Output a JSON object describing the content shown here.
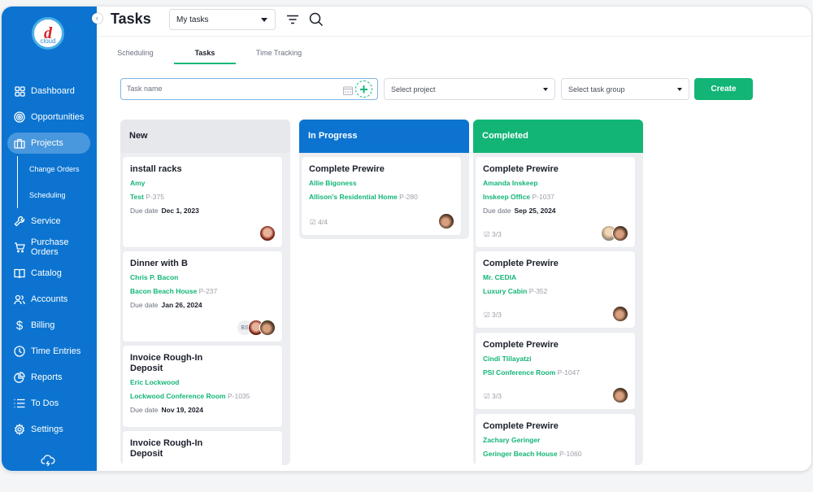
{
  "sidebar": {
    "logo_letter": "d",
    "logo_text": "cloud",
    "items": [
      {
        "label": "Dashboard",
        "icon": "dashboard-icon"
      },
      {
        "label": "Opportunities",
        "icon": "target-icon"
      },
      {
        "label": "Projects",
        "icon": "briefcase-icon",
        "active": true
      },
      {
        "label": "Change Orders",
        "sub": true
      },
      {
        "label": "Scheduling",
        "sub": true
      },
      {
        "label": "Service",
        "icon": "wrench-icon"
      },
      {
        "label": "Purchase Orders",
        "icon": "cart-icon"
      },
      {
        "label": "Catalog",
        "icon": "book-icon"
      },
      {
        "label": "Accounts",
        "icon": "users-icon"
      },
      {
        "label": "Billing",
        "icon": "dollar-icon"
      },
      {
        "label": "Time Entries",
        "icon": "clock-icon"
      },
      {
        "label": "Reports",
        "icon": "pie-chart-icon"
      },
      {
        "label": "To Dos",
        "icon": "list-icon"
      },
      {
        "label": "Settings",
        "icon": "gear-icon"
      }
    ],
    "purchase_line1": "Purchase",
    "purchase_line2": "Orders"
  },
  "header": {
    "title": "Tasks",
    "view_select": "My tasks"
  },
  "tabs": [
    {
      "label": "Scheduling"
    },
    {
      "label": "Tasks",
      "active": true
    },
    {
      "label": "Time Tracking"
    }
  ],
  "form": {
    "task_placeholder": "Task name",
    "project_placeholder": "Select project",
    "group_placeholder": "Select task group",
    "create_label": "Create"
  },
  "colors": {
    "sidebar": "#0c74d0",
    "accent_green": "#12b576",
    "in_progress": "#0c74d0"
  },
  "columns": [
    {
      "title": "New",
      "cards": [
        {
          "title": "install racks",
          "person": "Amy",
          "project": "Test",
          "pid": "P-375",
          "due_label": "Due date",
          "due": "Dec 1, 2023"
        },
        {
          "title": "Dinner with B",
          "person": "Chris P. Bacon",
          "project": "Bacon Beach House",
          "pid": "P-237",
          "due_label": "Due date",
          "due": "Jan 26, 2024",
          "initials": "BS"
        },
        {
          "title_1": "Invoice Rough-In",
          "title_2": "Deposit",
          "person": "Eric Lockwood",
          "project": "Lockwood Conference Room",
          "pid": "P-1035",
          "due_label": "Due date",
          "due": "Nov 19, 2024"
        },
        {
          "title_1": "Invoice Rough-In",
          "title_2": "Deposit"
        }
      ]
    },
    {
      "title": "In Progress",
      "cards": [
        {
          "title": "Complete Prewire",
          "person": "Allie Bigoness",
          "project": "Allison's Residential Home",
          "pid": "P-280",
          "checklist": "4/4"
        }
      ]
    },
    {
      "title": "Completed",
      "cards": [
        {
          "title": "Complete Prewire",
          "person": "Amanda Inskeep",
          "project": "Inskeep Office",
          "pid": "P-1037",
          "due_label": "Due date",
          "due": "Sep 25, 2024",
          "checklist": "3/3"
        },
        {
          "title": "Complete Prewire",
          "person": "Mr. CEDIA",
          "project": "Luxury Cabin",
          "pid": "P-352",
          "checklist": "3/3"
        },
        {
          "title": "Complete Prewire",
          "person": "Cindi Tlilayatzi",
          "project": "PSI Conference Room",
          "pid": "P-1047",
          "checklist": "3/3"
        },
        {
          "title": "Complete Prewire",
          "person": "Zachary Geringer",
          "project": "Geringer Beach House",
          "pid": "P-1060"
        }
      ]
    }
  ]
}
